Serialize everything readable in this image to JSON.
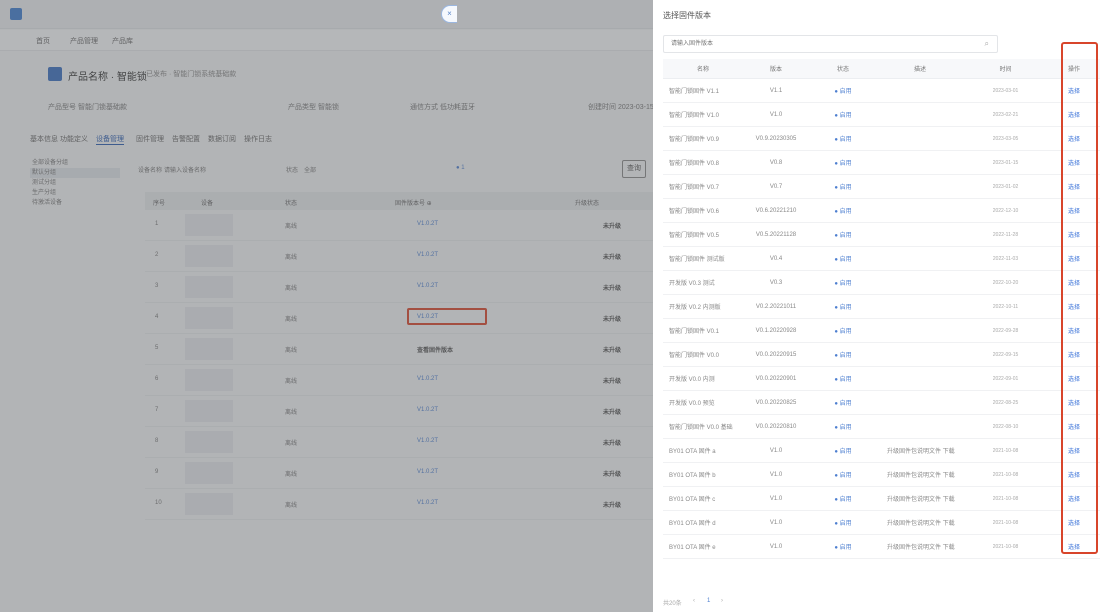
{
  "background_page": {
    "breadcrumb": [
      "首页",
      "产品管理",
      "产品库"
    ],
    "product_name": "产品名称 · 智能锁",
    "product_desc": "已发布 · 智能门锁系统基础款",
    "info": [
      "产品型号  智能门锁基础款",
      "产品类型  智能锁",
      "通信方式  低功耗蓝牙",
      "创建时间  2023-03-15"
    ],
    "tabs": [
      "基本信息",
      "功能定义",
      "设备管理",
      "固件管理",
      "告警配置",
      "数据订阅",
      "操作日志"
    ],
    "active_tab": "设备管理",
    "side_items": [
      "全部设备分组",
      "默认分组",
      "测试分组",
      "生产分组",
      "待激活设备"
    ],
    "toolbar": [
      "设备名称",
      "请输入设备名称",
      "状态",
      "全部"
    ],
    "query_button": "查询",
    "table_headers": [
      "序号",
      "设备",
      "状态",
      "固件版本号 ⊕",
      "",
      "升级状态"
    ],
    "rows": [
      {
        "idx": "1",
        "status": "离线",
        "version": "V1.0.2T",
        "upgrade": "未升级"
      },
      {
        "idx": "2",
        "status": "离线",
        "version": "V1.0.2T",
        "upgrade": "未升级"
      },
      {
        "idx": "3",
        "status": "离线",
        "version": "V1.0.2T",
        "upgrade": "未升级"
      },
      {
        "idx": "4",
        "status": "离线",
        "version": "V1.0.2T",
        "upgrade": "未升级"
      },
      {
        "idx": "5",
        "status": "离线",
        "version": "查看固件版本",
        "upgrade": "未升级"
      },
      {
        "idx": "6",
        "status": "离线",
        "version": "V1.0.2T",
        "upgrade": "未升级"
      },
      {
        "idx": "7",
        "status": "离线",
        "version": "V1.0.2T",
        "upgrade": "未升级"
      },
      {
        "idx": "8",
        "status": "离线",
        "version": "V1.0.2T",
        "upgrade": "未升级"
      },
      {
        "idx": "9",
        "status": "离线",
        "version": "V1.0.2T",
        "upgrade": "未升级"
      },
      {
        "idx": "10",
        "status": "离线",
        "version": "V1.0.2T",
        "upgrade": "未升级"
      }
    ]
  },
  "drawer": {
    "title": "选择固件版本",
    "close_symbol": "×",
    "search_placeholder": "请输入固件版本",
    "columns": [
      "名称",
      "版本",
      "状态",
      "描述",
      "时间",
      "操作"
    ],
    "rows": [
      {
        "name": "智能门锁固件 V1.1",
        "version": "V1.1",
        "status": "● 启用",
        "remark": "",
        "time": "2023-03-01",
        "op": "选择"
      },
      {
        "name": "智能门锁固件 V1.0",
        "version": "V1.0",
        "status": "● 启用",
        "remark": "",
        "time": "2023-02-21",
        "op": "选择"
      },
      {
        "name": "智能门锁固件 V0.9",
        "version": "V0.9.20230305",
        "status": "● 启用",
        "remark": "",
        "time": "2023-03-05",
        "op": "选择"
      },
      {
        "name": "智能门锁固件 V0.8",
        "version": "V0.8",
        "status": "● 启用",
        "remark": "",
        "time": "2023-01-15",
        "op": "选择"
      },
      {
        "name": "智能门锁固件 V0.7",
        "version": "V0.7",
        "status": "● 启用",
        "remark": "",
        "time": "2023-01-02",
        "op": "选择"
      },
      {
        "name": "智能门锁固件 V0.6",
        "version": "V0.6.20221210",
        "status": "● 启用",
        "remark": "",
        "time": "2022-12-10",
        "op": "选择"
      },
      {
        "name": "智能门锁固件 V0.5",
        "version": "V0.5.20221128",
        "status": "● 启用",
        "remark": "",
        "time": "2022-11-28",
        "op": "选择"
      },
      {
        "name": "智能门锁固件 测试版",
        "version": "V0.4",
        "status": "● 启用",
        "remark": "",
        "time": "2022-11-03",
        "op": "选择"
      },
      {
        "name": "开发版 V0.3 测试",
        "version": "V0.3",
        "status": "● 启用",
        "remark": "",
        "time": "2022-10-20",
        "op": "选择"
      },
      {
        "name": "开发版 V0.2 内测版",
        "version": "V0.2.20221011",
        "status": "● 启用",
        "remark": "",
        "time": "2022-10-11",
        "op": "选择"
      },
      {
        "name": "智能门锁固件 V0.1",
        "version": "V0.1.20220928",
        "status": "● 启用",
        "remark": "",
        "time": "2022-09-28",
        "op": "选择"
      },
      {
        "name": "智能门锁固件 V0.0",
        "version": "V0.0.20220915",
        "status": "● 启用",
        "remark": "",
        "time": "2022-09-15",
        "op": "选择"
      },
      {
        "name": "开发版 V0.0 内测",
        "version": "V0.0.20220901",
        "status": "● 启用",
        "remark": "",
        "time": "2022-09-01",
        "op": "选择"
      },
      {
        "name": "开发版 V0.0 预览",
        "version": "V0.0.20220825",
        "status": "● 启用",
        "remark": "",
        "time": "2022-08-25",
        "op": "选择"
      },
      {
        "name": "智能门锁固件 V0.0 基础",
        "version": "V0.0.20220810",
        "status": "● 启用",
        "remark": "",
        "time": "2022-08-10",
        "op": "选择"
      },
      {
        "name": "BY01 OTA 固件 a",
        "version": "V1.0",
        "status": "● 启用",
        "remark": "升级固件包说明文件 下载",
        "time": "2021-10-08",
        "op": "选择"
      },
      {
        "name": "BY01 OTA 固件 b",
        "version": "V1.0",
        "status": "● 启用",
        "remark": "升级固件包说明文件 下载",
        "time": "2021-10-08",
        "op": "选择"
      },
      {
        "name": "BY01 OTA 固件 c",
        "version": "V1.0",
        "status": "● 启用",
        "remark": "升级固件包说明文件 下载",
        "time": "2021-10-08",
        "op": "选择"
      },
      {
        "name": "BY01 OTA 固件 d",
        "version": "V1.0",
        "status": "● 启用",
        "remark": "升级固件包说明文件 下载",
        "time": "2021-10-08",
        "op": "选择"
      },
      {
        "name": "BY01 OTA 固件 e",
        "version": "V1.0",
        "status": "● 启用",
        "remark": "升级固件包说明文件 下载",
        "time": "2021-10-08",
        "op": "选择"
      }
    ],
    "pagination": {
      "total": "共20条",
      "prev": "‹",
      "current": "1",
      "next": "›"
    }
  },
  "colors": {
    "highlight": "#d8452b",
    "link": "#3b73d9",
    "overlay": "rgba(90,92,96,0.42)"
  }
}
